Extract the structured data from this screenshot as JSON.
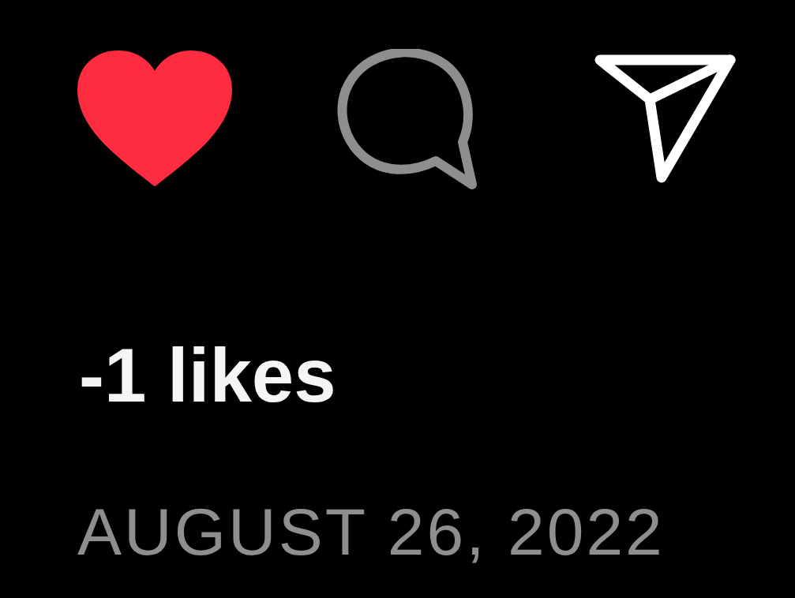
{
  "post": {
    "liked": true,
    "likes": "-1 likes",
    "date": "AUGUST 26, 2022"
  }
}
